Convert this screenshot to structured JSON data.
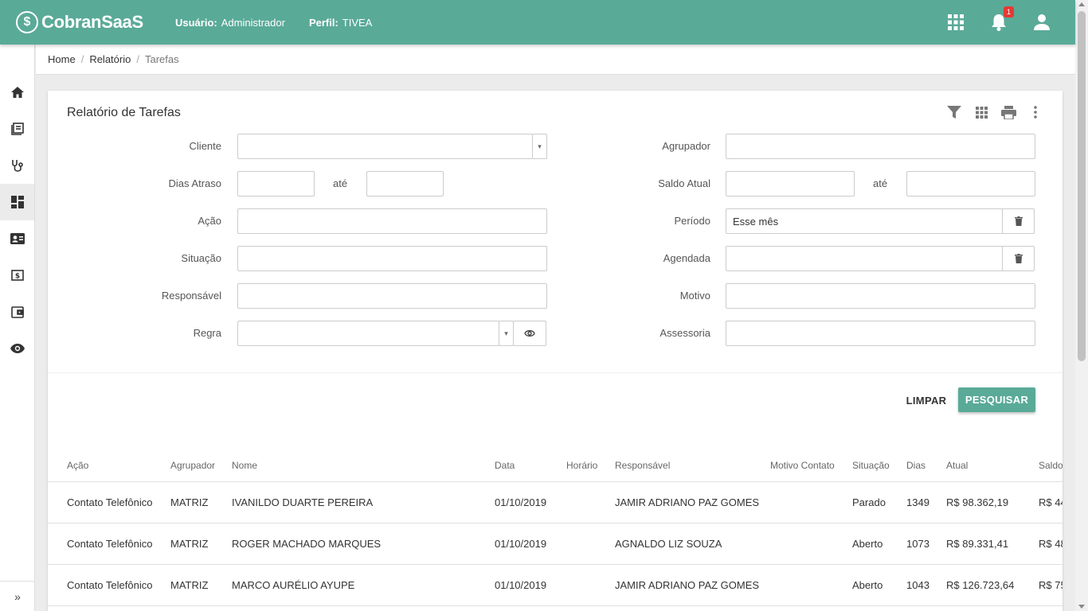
{
  "header": {
    "logo_mark": "$",
    "logo_text": "CobranSaaS",
    "user_label": "Usuário:",
    "user_value": "Administrador",
    "profile_label": "Perfil:",
    "profile_value": "TIVEA",
    "notifications_count": "1",
    "icons": [
      "apps-grid-icon",
      "bell-icon",
      "user-account-icon"
    ]
  },
  "sidebar": {
    "items": [
      "home-icon",
      "book-icon",
      "stethoscope-icon",
      "dashboard-icon",
      "contact-card-icon",
      "money-icon",
      "wallet-icon",
      "eye-icon"
    ],
    "active_index": 3,
    "expand_glyph": "»"
  },
  "breadcrumb": {
    "items": [
      "Home",
      "Relatório",
      "Tarefas"
    ],
    "separator": "/"
  },
  "card": {
    "title": "Relatório de Tarefas",
    "tools": [
      "filter-icon",
      "grid-icon",
      "print-icon",
      "more-vert-icon"
    ]
  },
  "form": {
    "cliente_label": "Cliente",
    "cliente_value": "",
    "dias_atraso_label": "Dias Atraso",
    "dias_from": "",
    "dias_to": "",
    "ate": "até",
    "acao_label": "Ação",
    "acao_value": "",
    "situacao_label": "Situação",
    "situacao_value": "",
    "responsavel_label": "Responsável",
    "responsavel_value": "",
    "regra_label": "Regra",
    "regra_value": "",
    "agrupador_label": "Agrupador",
    "agrupador_value": "",
    "saldo_label": "Saldo Atual",
    "saldo_from": "",
    "saldo_to": "",
    "periodo_label": "Período",
    "periodo_value": "Esse mês",
    "agendada_label": "Agendada",
    "agendada_value": "",
    "motivo_label": "Motivo",
    "motivo_value": "",
    "assessoria_label": "Assessoria",
    "assessoria_value": "",
    "dropdown_glyph": "▾"
  },
  "actions": {
    "clear_label": "LIMPAR",
    "search_label": "PESQUISAR"
  },
  "table": {
    "columns": [
      "Ação",
      "Agrupador",
      "Nome",
      "Data",
      "Horário",
      "Responsável",
      "Motivo Contato",
      "Situação",
      "Dias",
      "Atual",
      "Saldo"
    ],
    "rows": [
      [
        "Contato Telefônico",
        "MATRIZ",
        "IVANILDO DUARTE PEREIRA",
        "01/10/2019",
        "",
        "JAMIR ADRIANO PAZ GOMES",
        "",
        "Parado",
        "1349",
        "R$ 98.362,19",
        "R$ 44"
      ],
      [
        "Contato Telefônico",
        "MATRIZ",
        "ROGER MACHADO MARQUES",
        "01/10/2019",
        "",
        "AGNALDO LIZ SOUZA",
        "",
        "Aberto",
        "1073",
        "R$ 89.331,41",
        "R$ 48"
      ],
      [
        "Contato Telefônico",
        "MATRIZ",
        "MARCO AURÉLIO AYUPE",
        "01/10/2019",
        "",
        "JAMIR ADRIANO PAZ GOMES",
        "",
        "Aberto",
        "1043",
        "R$ 126.723,64",
        "R$ 75"
      ]
    ]
  },
  "colors": {
    "brand": "#5aaa98",
    "badge": "#e53935"
  }
}
